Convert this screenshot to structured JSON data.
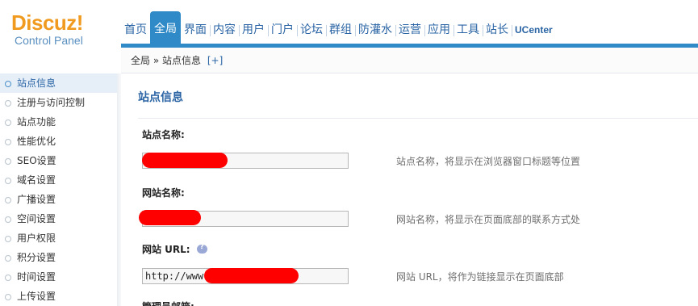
{
  "logo": {
    "title": "Discuz!",
    "subtitle": "Control Panel"
  },
  "nav": {
    "items": [
      {
        "label": "首页",
        "active": false
      },
      {
        "label": "全局",
        "active": true
      },
      {
        "label": "界面",
        "active": false
      },
      {
        "label": "内容",
        "active": false
      },
      {
        "label": "用户",
        "active": false
      },
      {
        "label": "门户",
        "active": false
      },
      {
        "label": "论坛",
        "active": false
      },
      {
        "label": "群组",
        "active": false
      },
      {
        "label": "防灌水",
        "active": false
      },
      {
        "label": "运营",
        "active": false
      },
      {
        "label": "应用",
        "active": false
      },
      {
        "label": "工具",
        "active": false
      },
      {
        "label": "站长",
        "active": false
      },
      {
        "label": "UCenter",
        "active": false
      }
    ]
  },
  "breadcrumb": {
    "root": "全局",
    "separator": "»",
    "current": "站点信息",
    "add": "[+]"
  },
  "sidebar": {
    "items": [
      {
        "label": "站点信息",
        "active": true
      },
      {
        "label": "注册与访问控制"
      },
      {
        "label": "站点功能"
      },
      {
        "label": "性能优化"
      },
      {
        "label": "SEO设置"
      },
      {
        "label": "域名设置"
      },
      {
        "label": "广播设置"
      },
      {
        "label": "空间设置"
      },
      {
        "label": "用户权限"
      },
      {
        "label": "积分设置"
      },
      {
        "label": "时间设置"
      },
      {
        "label": "上传设置"
      }
    ]
  },
  "main": {
    "title": "站点信息",
    "fields": [
      {
        "label": "站点名称:",
        "value": "",
        "tip": "站点名称，将显示在浏览器窗口标题等位置"
      },
      {
        "label": "网站名称:",
        "value": "",
        "tip": "网站名称，将显示在页面底部的联系方式处"
      },
      {
        "label": "网站 URL:",
        "value": "http://www",
        "tip": "网站 URL，将作为链接显示在页面底部",
        "icon": "help-icon"
      },
      {
        "label": "管理员邮箱:"
      }
    ]
  },
  "colors": {
    "accent": "#2f8ac7",
    "logo_orange": "#f09a20",
    "redaction": "#ff0000"
  }
}
